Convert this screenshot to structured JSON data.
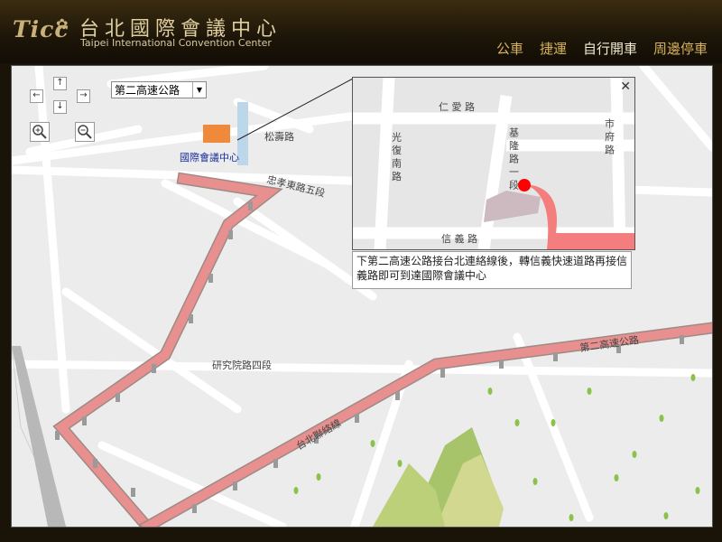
{
  "header": {
    "logo_text": "Ticc",
    "title_zh": "台北國際會議中心",
    "title_en": "Taipei International Convention Center"
  },
  "nav": [
    {
      "label": "公車"
    },
    {
      "label": "捷運"
    },
    {
      "label": "自行開車"
    },
    {
      "label": "周邊停車"
    }
  ],
  "map": {
    "route_select": "第二高速公路",
    "venue_label": "國際會議中心",
    "road_labels": {
      "ren_ai_5": "忠孝東路五段",
      "songshou": "松壽路",
      "yanjiuyuan": "研究院路四段",
      "highway2": "第二高速公路",
      "north_link": "台北聯絡線"
    },
    "popup_roads": {
      "ren_ai": "仁 愛 路",
      "guangfu": "光 復 南 路",
      "keelung": "基 隆 路 一 段",
      "shifu": "市 府 路",
      "xinyi": "信 義 路"
    },
    "caption": "下第二高速公路接台北連絡線後，轉信義快速道路再接信義路即可到達國際會議中心"
  },
  "colors": {
    "route": "#e87b7b",
    "accent": "#d6b25a"
  }
}
